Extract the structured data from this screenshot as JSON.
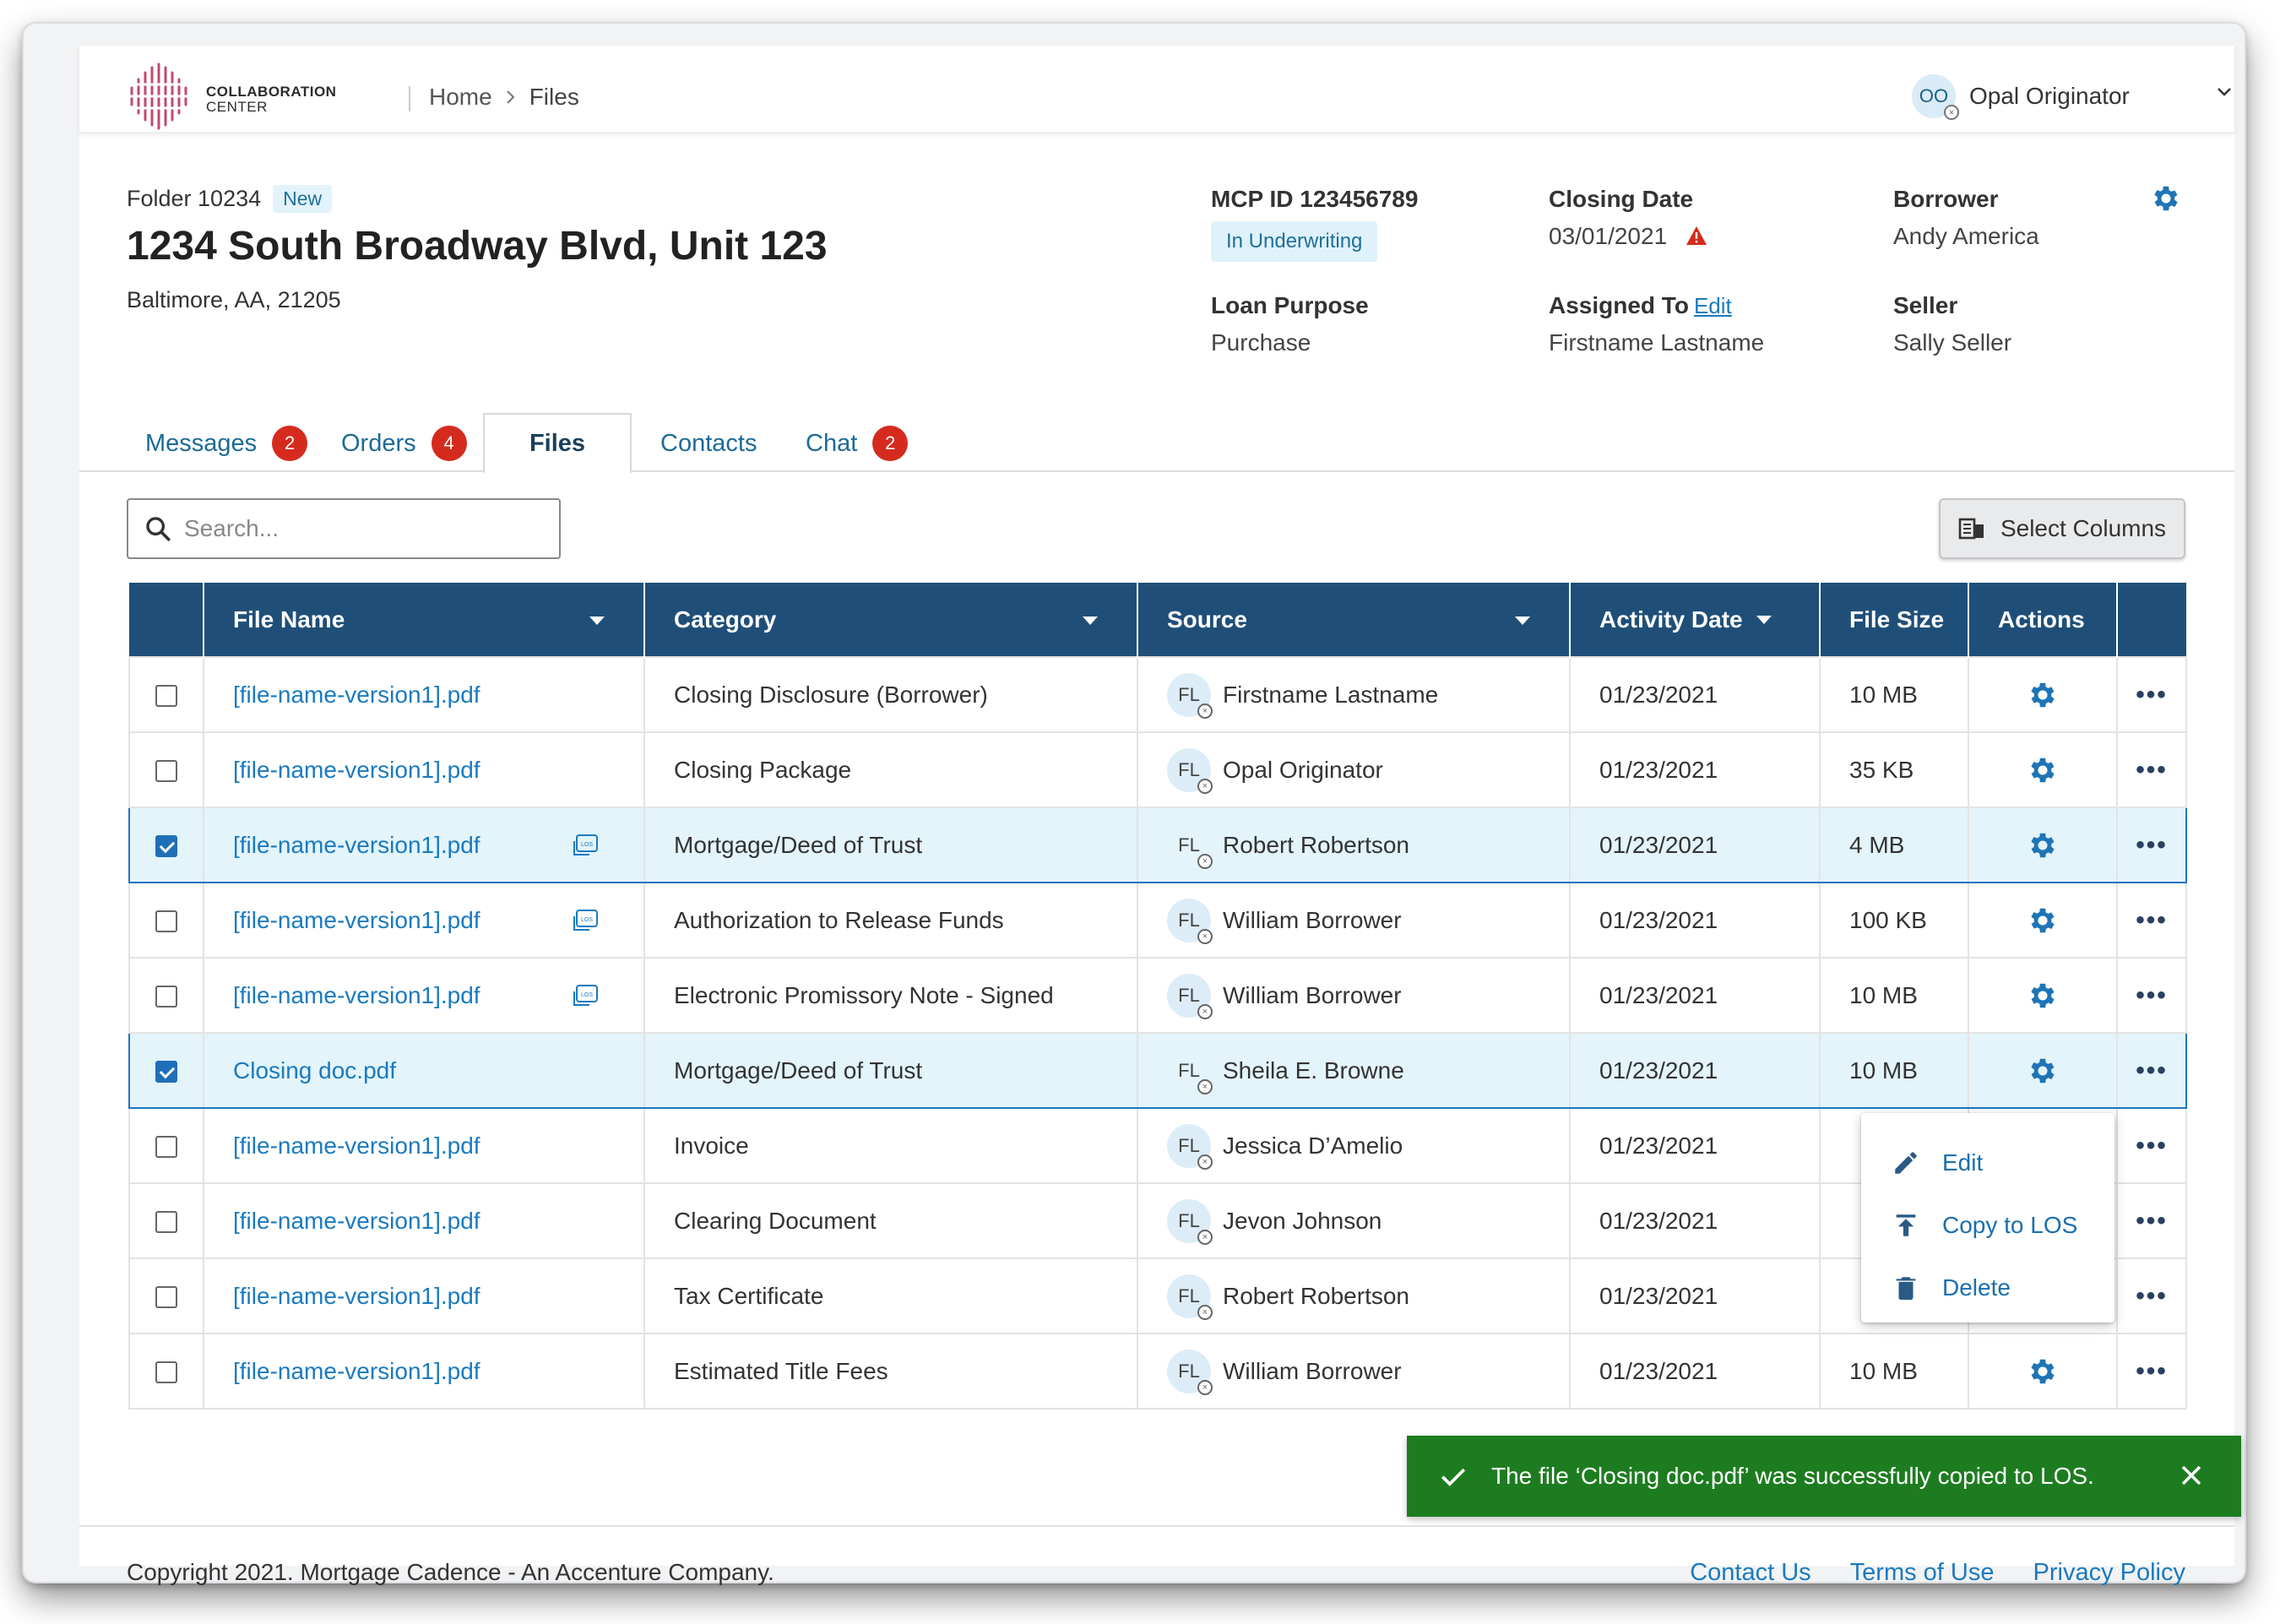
{
  "brand": {
    "name_line1": "COLLABORATION",
    "name_line2": "CENTER"
  },
  "breadcrumb": {
    "home": "Home",
    "current": "Files"
  },
  "user": {
    "initials": "OO",
    "name": "Opal Originator"
  },
  "folder": {
    "id_label": "Folder 10234",
    "badge": "New",
    "address": "1234 South Broadway Blvd, Unit 123",
    "city": "Baltimore, AA, 21205"
  },
  "meta": {
    "mcp_label": "MCP ID 123456789",
    "mcp_status": "In Underwriting",
    "loan_purpose_label": "Loan Purpose",
    "loan_purpose": "Purchase",
    "closing_date_label": "Closing Date",
    "closing_date": "03/01/2021",
    "assigned_label": "Assigned To",
    "assigned_edit": "Edit",
    "assigned_to": "Firstname Lastname",
    "borrower_label": "Borrower",
    "borrower": "Andy America",
    "seller_label": "Seller",
    "seller": "Sally Seller"
  },
  "tabs": [
    {
      "label": "Messages",
      "count": "2"
    },
    {
      "label": "Orders",
      "count": "4"
    },
    {
      "label": "Files",
      "count": ""
    },
    {
      "label": "Contacts",
      "count": ""
    },
    {
      "label": "Chat",
      "count": "2"
    }
  ],
  "search": {
    "placeholder": "Search..."
  },
  "select_columns_label": "Select Columns",
  "table": {
    "headers": [
      "File Name",
      "Category",
      "Source",
      "Activity Date",
      "File Size",
      "Actions"
    ],
    "rows": [
      {
        "checked": false,
        "file": "[file-name-version1].pdf",
        "los": false,
        "category": "Closing Disclosure (Borrower)",
        "src_initials": "FL",
        "source": "Firstname Lastname",
        "date": "01/23/2021",
        "size": "10 MB"
      },
      {
        "checked": false,
        "file": "[file-name-version1].pdf",
        "los": false,
        "category": "Closing Package",
        "src_initials": "FL",
        "source": "Opal Originator",
        "date": "01/23/2021",
        "size": "35 KB"
      },
      {
        "checked": true,
        "file": "[file-name-version1].pdf",
        "los": true,
        "category": "Mortgage/Deed of Trust",
        "src_initials": "FL",
        "source": "Robert Robertson",
        "date": "01/23/2021",
        "size": "4 MB"
      },
      {
        "checked": false,
        "file": "[file-name-version1].pdf",
        "los": true,
        "category": "Authorization to Release Funds",
        "src_initials": "FL",
        "source": "William Borrower",
        "date": "01/23/2021",
        "size": "100 KB"
      },
      {
        "checked": false,
        "file": "[file-name-version1].pdf",
        "los": true,
        "category": "Electronic Promissory Note - Signed",
        "src_initials": "FL",
        "source": "William Borrower",
        "date": "01/23/2021",
        "size": "10 MB"
      },
      {
        "checked": true,
        "file": "Closing doc.pdf",
        "los": false,
        "category": "Mortgage/Deed of Trust",
        "src_initials": "FL",
        "source": "Sheila E. Browne",
        "date": "01/23/2021",
        "size": "10 MB"
      },
      {
        "checked": false,
        "file": "[file-name-version1].pdf",
        "los": false,
        "category": "Invoice",
        "src_initials": "FL",
        "source": "Jessica D’Amelio",
        "date": "01/23/2021",
        "size": ""
      },
      {
        "checked": false,
        "file": "[file-name-version1].pdf",
        "los": false,
        "category": "Clearing Document",
        "src_initials": "FL",
        "source": "Jevon Johnson",
        "date": "01/23/2021",
        "size": ""
      },
      {
        "checked": false,
        "file": "[file-name-version1].pdf",
        "los": false,
        "category": "Tax Certificate",
        "src_initials": "FL",
        "source": "Robert Robertson",
        "date": "01/23/2021",
        "size": ""
      },
      {
        "checked": false,
        "file": "[file-name-version1].pdf",
        "los": false,
        "category": "Estimated Title Fees",
        "src_initials": "FL",
        "source": "William Borrower",
        "date": "01/23/2021",
        "size": "10 MB"
      }
    ]
  },
  "action_menu": {
    "edit": "Edit",
    "copy": "Copy to LOS",
    "delete": "Delete"
  },
  "toast": {
    "message": "The file ‘Closing doc.pdf’ was successfully copied to LOS."
  },
  "footer": {
    "copyright": "Copyright 2021. Mortgage Cadence - An Accenture Company.",
    "links": [
      "Contact Us",
      "Terms of Use",
      "Privacy Policy"
    ]
  },
  "colors": {
    "header": "#1f4f78",
    "link": "#1a7ac0",
    "badge": "#d52b1e",
    "toast": "#1e7c20",
    "selected_row": "#e3f4fb"
  }
}
